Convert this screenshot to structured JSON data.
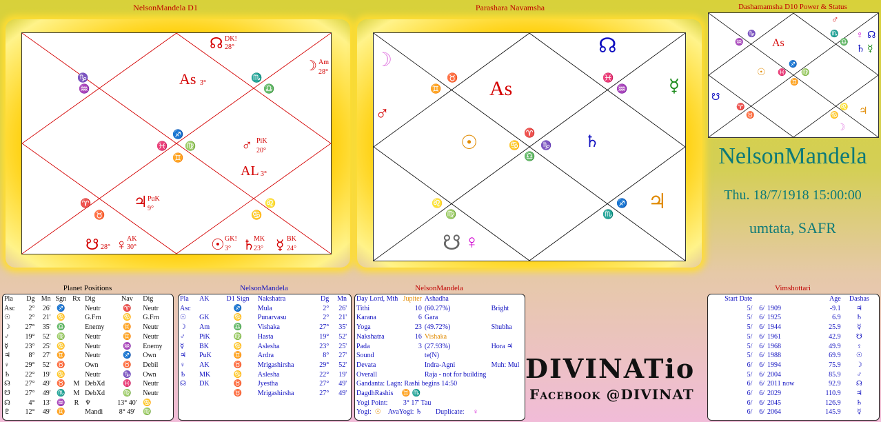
{
  "titles": {
    "d1": "NelsonMandela D1",
    "navamsha": "Parashara Navamsha",
    "d10": "Dashamamsha D10 Power & Status"
  },
  "d1": {
    "asc": "As",
    "asc_deg": "3°",
    "al": "AL",
    "al_deg": "3°",
    "signs": {
      "h1": "♑",
      "h1b": "♒",
      "h2": "♏",
      "h2b": "♎",
      "center1": "♐",
      "center2": "♓",
      "center3": "♍",
      "center4": "♊",
      "h7a": "♈",
      "h7b": "♉",
      "h10a": "♌",
      "h10b": "♋"
    },
    "planets": [
      {
        "sym": "☊",
        "tag": "DK!",
        "deg": "28°"
      },
      {
        "sym": "☽",
        "tag": "Am",
        "deg": "28°"
      },
      {
        "sym": "♂",
        "tag": "PiK",
        "deg": "20°"
      },
      {
        "sym": "♃",
        "tag": "PuK",
        "deg": "9°"
      },
      {
        "sym": "☋",
        "tag": "",
        "deg": "28°"
      },
      {
        "sym": "♀",
        "tag": "AK",
        "deg": "30°"
      },
      {
        "sym": "☉",
        "tag": "GK!",
        "deg": "3°"
      },
      {
        "sym": "♄",
        "tag": "MK",
        "deg": "23°"
      },
      {
        "sym": "☿",
        "tag": "BK",
        "deg": "24°"
      }
    ]
  },
  "nav": {
    "asc": "As",
    "signs": {
      "s1": "♉",
      "s2": "♊",
      "s3": "♓",
      "s4": "♒",
      "s5": "♈",
      "s6": "♋",
      "s7": "♑",
      "s8": "♎",
      "s9": "♌",
      "s10": "♍",
      "s11": "♐",
      "s12": "♏"
    },
    "planets": {
      "moon": "☽",
      "mars": "♂",
      "node": "☊",
      "mercury": "☿",
      "sun": "☉",
      "saturn": "♄",
      "jupiter": "♃",
      "ketu": "☋",
      "venus": "♀"
    }
  },
  "d10": {
    "asc": "As",
    "signs": [
      "♑",
      "♒",
      "♏",
      "♎",
      "♐",
      "♓",
      "♍",
      "♊",
      "♈",
      "♉",
      "♌",
      "♋"
    ],
    "planets": {
      "mars": "♂",
      "venus": "♀",
      "node": "☊",
      "mercury": "☿",
      "sun": "☉",
      "saturn": "♄",
      "jupiter": "♃",
      "moon": "☽",
      "ketu": "☋"
    }
  },
  "info": {
    "name": "NelsonMandela",
    "date": "Thu. 18/7/1918  15:00:00",
    "place": "umtata, SAFR"
  },
  "brand": {
    "line1": "DIVINATio",
    "line2": "Facebook @DIVINAT"
  },
  "planet_positions": {
    "title": "Planet Positions",
    "headers": [
      "Pla",
      "Dg",
      "Mn",
      "Sgn",
      "Rx",
      "Dig",
      "Nav",
      "Dig"
    ],
    "rows": [
      [
        "Asc",
        "2°",
        "26'",
        "♐",
        "",
        "Neutr",
        "♈",
        "Neutr"
      ],
      [
        "☉",
        "2°",
        "21'",
        "♋",
        "",
        "G.Frn",
        "♋",
        "G.Frn"
      ],
      [
        "☽",
        "27°",
        "35'",
        "♎",
        "",
        "Enemy",
        "♊",
        "Neutr"
      ],
      [
        "♂",
        "19°",
        "52'",
        "♍",
        "",
        "Neutr",
        "♊",
        "Neutr"
      ],
      [
        "☿",
        "23°",
        "25'",
        "♋",
        "",
        "Neutr",
        "♒",
        "Enemy"
      ],
      [
        "♃",
        "8°",
        "27'",
        "♊",
        "",
        "Neutr",
        "♐",
        "Own"
      ],
      [
        "♀",
        "29°",
        "52'",
        "♉",
        "",
        "Own",
        "♉",
        "Debil"
      ],
      [
        "♄",
        "22°",
        "19'",
        "♋",
        "",
        "Neutr",
        "♑",
        "Own"
      ],
      [
        "☊",
        "27°",
        "49'",
        "♉",
        "M",
        "DebXd",
        "♓",
        "Neutr"
      ],
      [
        "☋",
        "27°",
        "49'",
        "♏",
        "M",
        "DebXd",
        "♍",
        "Neutr"
      ],
      [
        "☊",
        "4°",
        "13'",
        "♒",
        "R",
        "♆",
        "13° 40'",
        "♋"
      ],
      [
        "♇",
        "12°",
        "49'",
        "♊",
        "",
        "Mandi",
        "8° 49'",
        "♍"
      ]
    ]
  },
  "karakas": {
    "title": "NelsonMandela",
    "headers": [
      "Pla",
      "AK",
      "D1 Sign",
      "Nakshatra",
      "Dg",
      "Mn"
    ],
    "rows": [
      [
        "Asc",
        "",
        "♐",
        "Mula",
        "2°",
        "26'"
      ],
      [
        "☉",
        "GK",
        "♋",
        "Punarvasu",
        "2°",
        "21'"
      ],
      [
        "☽",
        "Am",
        "♎",
        "Vishaka",
        "27°",
        "35'"
      ],
      [
        "♂",
        "PiK",
        "♍",
        "Hasta",
        "19°",
        "52'"
      ],
      [
        "☿",
        "BK",
        "♋",
        "Aslesha",
        "23°",
        "25'"
      ],
      [
        "♃",
        "PuK",
        "♊",
        "Ardra",
        "8°",
        "27'"
      ],
      [
        "♀",
        "AK",
        "♉",
        "Mrigashirsha",
        "29°",
        "52'"
      ],
      [
        "♄",
        "MK",
        "♋",
        "Aslesha",
        "22°",
        "19'"
      ],
      [
        "☊",
        "DK",
        "♉",
        "Jyestha",
        "27°",
        "49'"
      ],
      [
        "",
        "",
        "♉",
        "Mrigashirsha",
        "27°",
        "49'"
      ]
    ]
  },
  "panchang": {
    "title": "NelsonMandela",
    "rows": [
      [
        "Day Lord, Mth",
        "Jupiter",
        "Ashadha",
        ""
      ],
      [
        "Tithi",
        "10",
        "(60.27%)",
        "Bright"
      ],
      [
        "Karana",
        "6",
        "Gara",
        ""
      ],
      [
        "Yoga",
        "23",
        "(49.72%)",
        "Shubha"
      ],
      [
        "Nakshatra",
        "16",
        "Vishaka",
        ""
      ],
      [
        "Pada",
        "3",
        "(27.93%)",
        "Hora  ♃"
      ],
      [
        "Sound",
        "",
        "te(N)",
        ""
      ],
      [
        "Devata",
        "",
        "Indra-Agni",
        "Muh:  Mul"
      ],
      [
        "Overall",
        "",
        "Raja - not for building",
        ""
      ]
    ],
    "ganda": "Gandanta: Lagn: Rashi begins 14:50",
    "dagdh": "DagdhRashis",
    "dagdh_signs": "♊   ♏",
    "yogi_point": "Yogi Point:",
    "yogi_point_val": "3° 17' Tau",
    "yogi": "Yogi:",
    "avayogi": "AvaYogi:",
    "duplicate": "Duplicate:",
    "yogi_sym": "☉",
    "avayogi_sym": "♄",
    "dup_sym": "♀"
  },
  "vimshottari": {
    "title": "Vimshottari",
    "headers": [
      "Start Date",
      "",
      "",
      "",
      "Age",
      "Dashas"
    ],
    "rows": [
      [
        "5/",
        "6/",
        "1909",
        "",
        "-9.1",
        "♃"
      ],
      [
        "5/",
        "6/",
        "1925",
        "",
        "6.9",
        "♄"
      ],
      [
        "5/",
        "6/",
        "1944",
        "",
        "25.9",
        "☿"
      ],
      [
        "5/",
        "6/",
        "1961",
        "",
        "42.9",
        "☋"
      ],
      [
        "5/",
        "6/",
        "1968",
        "",
        "49.9",
        "♀"
      ],
      [
        "5/",
        "6/",
        "1988",
        "",
        "69.9",
        "☉"
      ],
      [
        "6/",
        "6/",
        "1994",
        "",
        "75.9",
        "☽"
      ],
      [
        "5/",
        "6/",
        "2004",
        "",
        "85.9",
        "♂"
      ],
      [
        "6/",
        "6/",
        "2011 now",
        "",
        "92.9",
        "☊"
      ],
      [
        "6/",
        "6/",
        "2029",
        "",
        "110.9",
        "♃"
      ],
      [
        "6/",
        "6/",
        "2045",
        "",
        "126.9",
        "♄"
      ],
      [
        "6/",
        "6/",
        "2064",
        "",
        "145.9",
        "☿"
      ]
    ]
  }
}
